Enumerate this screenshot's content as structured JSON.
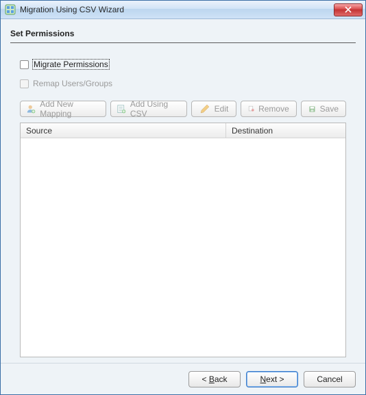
{
  "window": {
    "title": "Migration Using CSV Wizard"
  },
  "header": {
    "title": "Set Permissions"
  },
  "checkboxes": {
    "migrate_permissions": "Migrate Permissions",
    "remap_users_groups": "Remap Users/Groups"
  },
  "toolbar": {
    "add_new_mapping": "Add New Mapping",
    "add_using_csv": "Add Using CSV",
    "edit": "Edit",
    "remove": "Remove",
    "save": "Save"
  },
  "table": {
    "col_source": "Source",
    "col_destination": "Destination"
  },
  "footer": {
    "back_prefix": "< ",
    "back_accel": "B",
    "back_rest": "ack",
    "next_accel": "N",
    "next_rest": "ext >",
    "cancel": "Cancel"
  }
}
